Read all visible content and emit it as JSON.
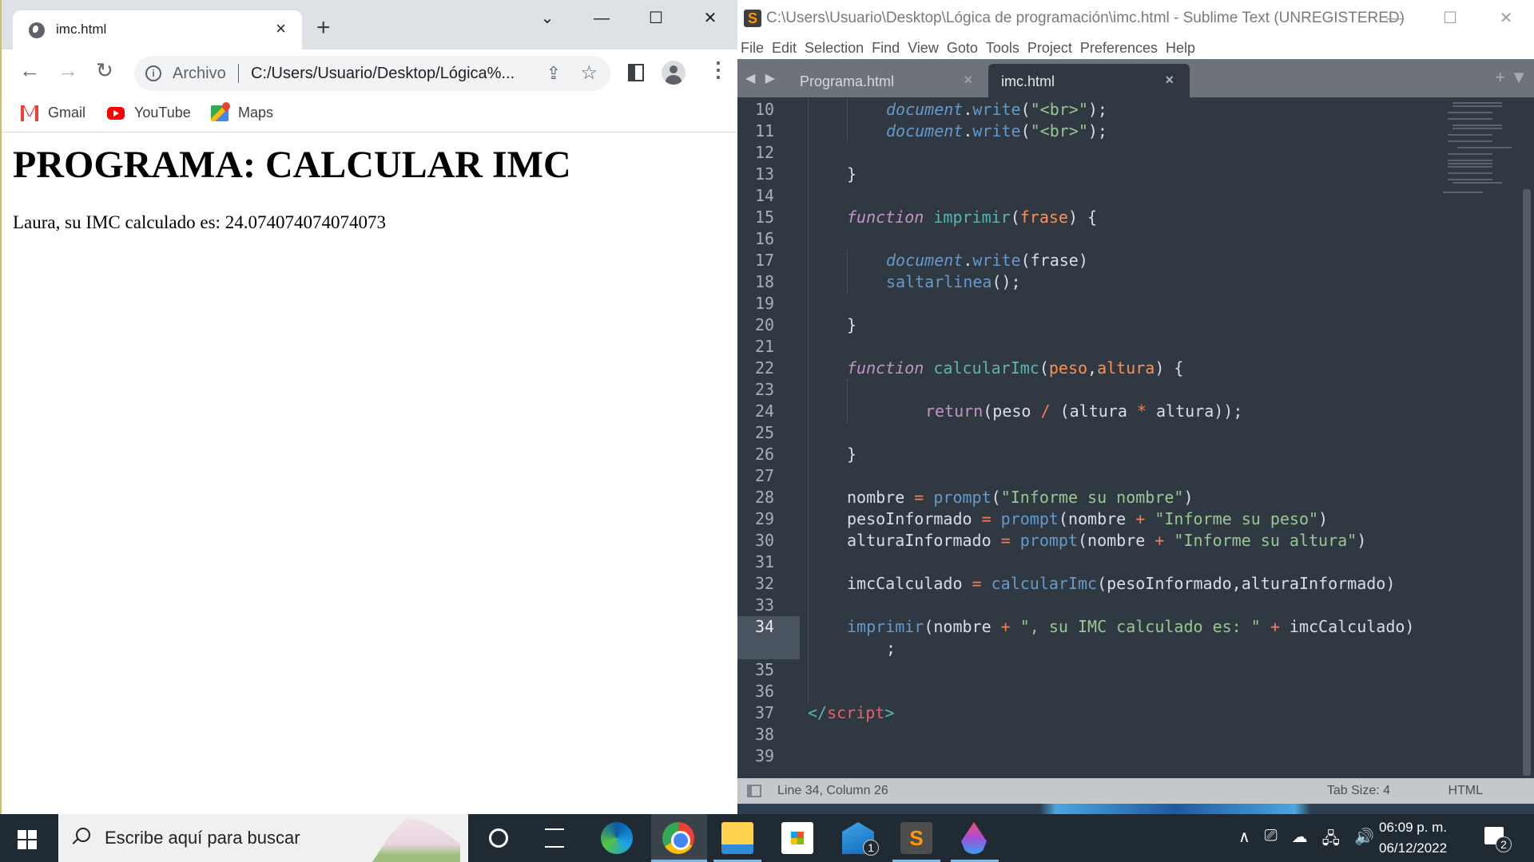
{
  "chrome": {
    "tab": {
      "title": "imc.html",
      "close": "×"
    },
    "new_tab": "+",
    "window_controls": {
      "dropdown": "⌄",
      "minimize": "—",
      "maximize": "☐",
      "close": "✕"
    },
    "nav": {
      "back": "←",
      "forward": "→",
      "reload": "↻"
    },
    "omnibox": {
      "info": "i",
      "scheme": "Archivo",
      "url": "C:/Users/Usuario/Desktop/Lógica%...",
      "share": "⇪",
      "bookmark": "☆"
    },
    "menu": "⋮",
    "bookmarks": [
      {
        "label": "Gmail",
        "icon": "gmail-icon"
      },
      {
        "label": "YouTube",
        "icon": "youtube-icon"
      },
      {
        "label": "Maps",
        "icon": "maps-icon"
      }
    ],
    "page": {
      "heading": "PROGRAMA: CALCULAR IMC",
      "result": "Laura, su IMC calculado es: 24.074074074074073"
    }
  },
  "sublime": {
    "logo": "S",
    "title": "C:\\Users\\Usuario\\Desktop\\Lógica de programación\\imc.html - Sublime Text (UNREGISTERED)",
    "window_controls": {
      "minimize": "—",
      "maximize": "☐",
      "close": "✕"
    },
    "menu": [
      "File",
      "Edit",
      "Selection",
      "Find",
      "View",
      "Goto",
      "Tools",
      "Project",
      "Preferences",
      "Help"
    ],
    "tab_arrows": "◀ ▶",
    "tabs": [
      {
        "label": "Programa.html",
        "close": "×",
        "active": false
      },
      {
        "label": "imc.html",
        "close": "×",
        "active": true
      }
    ],
    "tab_tools": "+ ▼",
    "editor": {
      "cursor_line": 34,
      "lines": [
        {
          "n": "10",
          "indent": 2
        },
        {
          "n": "11",
          "indent": 2
        },
        {
          "n": "12"
        },
        {
          "n": "13",
          "indent": 1
        },
        {
          "n": "14"
        },
        {
          "n": "15",
          "indent": 1
        },
        {
          "n": "16"
        },
        {
          "n": "17",
          "indent": 2
        },
        {
          "n": "18",
          "indent": 2
        },
        {
          "n": "19"
        },
        {
          "n": "20",
          "indent": 1
        },
        {
          "n": "21"
        },
        {
          "n": "22",
          "indent": 1
        },
        {
          "n": "23"
        },
        {
          "n": "24",
          "indent": 3
        },
        {
          "n": "25"
        },
        {
          "n": "26",
          "indent": 1
        },
        {
          "n": "27"
        },
        {
          "n": "28",
          "indent": 1
        },
        {
          "n": "29",
          "indent": 1
        },
        {
          "n": "30",
          "indent": 1
        },
        {
          "n": "31"
        },
        {
          "n": "32",
          "indent": 1
        },
        {
          "n": "33"
        },
        {
          "n": "34",
          "indent": 1
        },
        {
          "n": "",
          "indent": 2
        },
        {
          "n": "35"
        },
        {
          "n": "36"
        },
        {
          "n": "37",
          "indent": 0
        },
        {
          "n": "38"
        },
        {
          "n": "39"
        }
      ],
      "tokens": {
        "l10": [
          [
            "document",
            "k-doc"
          ],
          [
            ".",
            ""
          ],
          [
            "write",
            "k-call"
          ],
          [
            "(",
            ""
          ],
          [
            "\"<br>\"",
            "k-str"
          ],
          [
            ");",
            ""
          ]
        ],
        "l11": [
          [
            "document",
            "k-doc"
          ],
          [
            ".",
            ""
          ],
          [
            "write",
            "k-call"
          ],
          [
            "(",
            ""
          ],
          [
            "\"<br>\"",
            "k-str"
          ],
          [
            ");",
            ""
          ]
        ],
        "l13": [
          [
            "}",
            ""
          ]
        ],
        "l15": [
          [
            "function",
            "k-fn"
          ],
          [
            " ",
            ""
          ],
          [
            "imprimir",
            "k-name"
          ],
          [
            "(",
            ""
          ],
          [
            "frase",
            "k-param"
          ],
          [
            ") {",
            ""
          ]
        ],
        "l17": [
          [
            "document",
            "k-doc"
          ],
          [
            ".",
            ""
          ],
          [
            "write",
            "k-call"
          ],
          [
            "(frase)",
            ""
          ]
        ],
        "l18": [
          [
            "saltarlinea",
            "k-call"
          ],
          [
            "();",
            ""
          ]
        ],
        "l20": [
          [
            "}",
            ""
          ]
        ],
        "l22": [
          [
            "function",
            "k-fn"
          ],
          [
            " ",
            ""
          ],
          [
            "calcularImc",
            "k-name"
          ],
          [
            "(",
            ""
          ],
          [
            "peso",
            "k-param"
          ],
          [
            ",",
            ""
          ],
          [
            "altura",
            "k-param"
          ],
          [
            ") {",
            ""
          ]
        ],
        "l24": [
          [
            "return",
            "k-ret"
          ],
          [
            "(peso ",
            ""
          ],
          [
            "/",
            "k-op"
          ],
          [
            " (altura ",
            ""
          ],
          [
            "*",
            "k-op"
          ],
          [
            " altura));",
            ""
          ]
        ],
        "l26": [
          [
            "}",
            ""
          ]
        ],
        "l28": [
          [
            "nombre ",
            ""
          ],
          [
            "=",
            "k-op"
          ],
          [
            " ",
            ""
          ],
          [
            "prompt",
            "k-call"
          ],
          [
            "(",
            ""
          ],
          [
            "\"Informe su nombre\"",
            "k-str"
          ],
          [
            ")",
            ""
          ]
        ],
        "l29": [
          [
            "pesoInformado ",
            ""
          ],
          [
            "=",
            "k-op"
          ],
          [
            " ",
            ""
          ],
          [
            "prompt",
            "k-call"
          ],
          [
            "(nombre ",
            ""
          ],
          [
            "+",
            "k-op"
          ],
          [
            " ",
            ""
          ],
          [
            "\"Informe su peso\"",
            "k-str"
          ],
          [
            ")",
            ""
          ]
        ],
        "l30": [
          [
            "alturaInformado ",
            ""
          ],
          [
            "=",
            "k-op"
          ],
          [
            " ",
            ""
          ],
          [
            "prompt",
            "k-call"
          ],
          [
            "(nombre ",
            ""
          ],
          [
            "+",
            "k-op"
          ],
          [
            " ",
            ""
          ],
          [
            "\"Informe su altura\"",
            "k-str"
          ],
          [
            ")",
            ""
          ]
        ],
        "l32": [
          [
            "imcCalculado ",
            ""
          ],
          [
            "=",
            "k-op"
          ],
          [
            " ",
            ""
          ],
          [
            "calcularImc",
            "k-call"
          ],
          [
            "(pesoInformado,alturaInformado)",
            ""
          ]
        ],
        "l34": [
          [
            "imprimir",
            "k-call"
          ],
          [
            "(nombre ",
            ""
          ],
          [
            "+",
            "k-op"
          ],
          [
            " ",
            ""
          ],
          [
            "\", su IMC calculado es: \"",
            "k-str"
          ],
          [
            " ",
            ""
          ],
          [
            "+",
            "k-op"
          ],
          [
            " imcCalculado)",
            ""
          ]
        ],
        "l34b": [
          [
            ";",
            ""
          ]
        ],
        "l37": [
          [
            "</",
            "k-punct"
          ],
          [
            "script",
            "k-tag"
          ],
          [
            ">",
            "k-punct"
          ]
        ]
      }
    },
    "status": {
      "position": "Line 34, Column 26",
      "tab_size": "Tab Size: 4",
      "syntax": "HTML"
    }
  },
  "taskbar": {
    "search_placeholder": "Escribe aquí para buscar",
    "apps": [
      {
        "name": "cortana",
        "badge": ""
      },
      {
        "name": "task-view",
        "badge": ""
      },
      {
        "name": "edge",
        "badge": ""
      },
      {
        "name": "chrome",
        "badge": "",
        "active": true
      },
      {
        "name": "file-explorer",
        "badge": ""
      },
      {
        "name": "microsoft-store",
        "badge": ""
      },
      {
        "name": "mail",
        "badge": "1"
      },
      {
        "name": "sublime-text",
        "badge": ""
      },
      {
        "name": "paint",
        "badge": ""
      }
    ],
    "tray": {
      "chevron": "∧",
      "meet": "⎚",
      "onedrive": "☁",
      "network": "🖧",
      "volume": "🔊"
    },
    "time": "06:09 p. m.",
    "date": "06/12/2022",
    "notifications": "2"
  }
}
